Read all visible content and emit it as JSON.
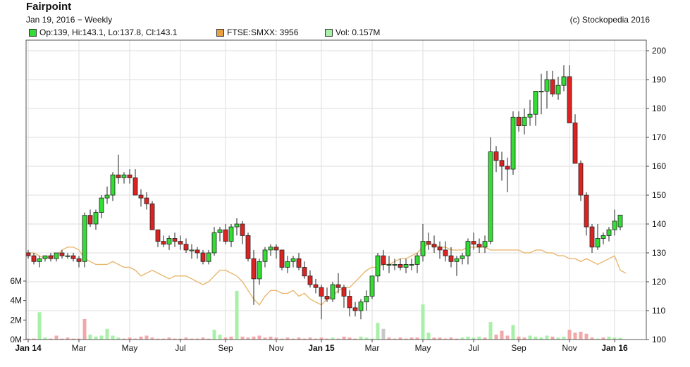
{
  "header": {
    "title": "Fairpoint",
    "subtitle": "Jan 19, 2016 − Weekly",
    "copyright": "(c) Stockopedia 2016"
  },
  "legend": {
    "ohlc": "Op:139, Hi:143.1, Lo:137.8, Cl:143.1",
    "index": "FTSE:SMXX: 3956",
    "volume": "Vol: 0.157M"
  },
  "colors": {
    "up": "#33dd33",
    "down": "#dd2222",
    "index_line": "#e8b870",
    "vol_up": "#a8f0a8",
    "vol_down": "#f2a8a8",
    "grid": "#dddddd"
  },
  "chart_data": {
    "type": "candlestick",
    "price_axis": {
      "side": "right",
      "ticks": [
        100,
        110,
        120,
        130,
        140,
        150,
        160,
        170,
        180,
        190,
        200
      ],
      "ylim": [
        100,
        200
      ]
    },
    "volume_axis": {
      "side": "left",
      "ticks": [
        "0M",
        "2M",
        "4M",
        "6M"
      ],
      "ylim": [
        0,
        6
      ]
    },
    "x_ticks": [
      {
        "label": "Jan 14",
        "week": 0,
        "bold": true
      },
      {
        "label": "Mar",
        "week": 9
      },
      {
        "label": "May",
        "week": 18
      },
      {
        "label": "Jul",
        "week": 27
      },
      {
        "label": "Sep",
        "week": 35
      },
      {
        "label": "Nov",
        "week": 44
      },
      {
        "label": "Jan 15",
        "week": 52,
        "bold": true
      },
      {
        "label": "Mar",
        "week": 61
      },
      {
        "label": "May",
        "week": 70
      },
      {
        "label": "Jul",
        "week": 79
      },
      {
        "label": "Sep",
        "week": 87
      },
      {
        "label": "Nov",
        "week": 96
      },
      {
        "label": "Jan 16",
        "week": 104,
        "bold": true
      }
    ],
    "candles": [
      [
        130,
        131,
        128,
        129
      ],
      [
        129,
        130,
        126,
        127
      ],
      [
        127,
        129,
        125,
        128
      ],
      [
        128,
        129,
        127,
        129
      ],
      [
        129,
        130,
        127,
        128
      ],
      [
        128,
        130,
        127,
        130
      ],
      [
        130,
        131,
        128,
        129
      ],
      [
        129,
        130,
        128,
        129
      ],
      [
        129,
        130,
        127,
        128
      ],
      [
        128,
        129,
        125,
        127
      ],
      [
        127,
        144,
        125,
        143
      ],
      [
        143,
        145,
        139,
        140
      ],
      [
        140,
        145,
        138,
        144
      ],
      [
        144,
        150,
        142,
        149
      ],
      [
        149,
        153,
        147,
        150
      ],
      [
        150,
        158,
        148,
        157
      ],
      [
        157,
        164,
        154,
        156
      ],
      [
        156,
        158,
        154,
        157
      ],
      [
        157,
        159,
        154,
        156
      ],
      [
        156,
        159,
        151,
        150
      ],
      [
        150,
        152,
        146,
        149
      ],
      [
        149,
        151,
        145,
        147
      ],
      [
        147,
        148,
        138,
        138
      ],
      [
        138,
        135,
        132,
        134
      ],
      [
        134,
        136,
        132,
        133
      ],
      [
        133,
        136,
        131,
        135
      ],
      [
        135,
        137,
        132,
        134
      ],
      [
        134,
        136,
        131,
        133
      ],
      [
        133,
        135,
        130,
        131
      ],
      [
        131,
        133,
        128,
        131
      ],
      [
        131,
        132,
        128,
        130
      ],
      [
        130,
        131,
        126,
        127
      ],
      [
        127,
        131,
        126,
        130
      ],
      [
        130,
        139,
        129,
        137
      ],
      [
        137,
        139,
        134,
        138
      ],
      [
        138,
        140,
        133,
        134
      ],
      [
        134,
        140,
        132,
        139
      ],
      [
        139,
        142,
        136,
        140
      ],
      [
        140,
        141,
        133,
        136
      ],
      [
        136,
        137,
        127,
        128
      ],
      [
        128,
        131,
        112,
        121
      ],
      [
        121,
        128,
        119,
        127
      ],
      [
        127,
        132,
        125,
        131
      ],
      [
        131,
        133,
        129,
        132
      ],
      [
        132,
        133,
        128,
        131
      ],
      [
        131,
        131,
        124,
        125
      ],
      [
        125,
        129,
        123,
        127
      ],
      [
        127,
        129,
        125,
        128
      ],
      [
        128,
        130,
        124,
        125
      ],
      [
        125,
        127,
        121,
        122
      ],
      [
        122,
        124,
        118,
        119
      ],
      [
        119,
        121,
        116,
        118
      ],
      [
        118,
        119,
        107,
        115
      ],
      [
        115,
        118,
        113,
        114
      ],
      [
        114,
        120,
        113,
        119
      ],
      [
        119,
        123,
        116,
        118
      ],
      [
        118,
        119,
        111,
        115
      ],
      [
        115,
        117,
        108,
        111
      ],
      [
        111,
        113,
        108,
        110
      ],
      [
        110,
        114,
        107,
        113
      ],
      [
        113,
        117,
        110,
        115
      ],
      [
        115,
        122,
        114,
        122
      ],
      [
        122,
        130,
        120,
        129
      ],
      [
        129,
        131,
        124,
        126
      ],
      [
        126,
        129,
        123,
        126
      ],
      [
        126,
        128,
        124,
        126
      ],
      [
        126,
        128,
        124,
        125
      ],
      [
        125,
        128,
        123,
        126
      ],
      [
        126,
        128,
        124,
        126
      ],
      [
        126,
        130,
        123,
        129
      ],
      [
        129,
        140,
        127,
        134
      ],
      [
        134,
        137,
        131,
        133
      ],
      [
        133,
        136,
        130,
        132
      ],
      [
        132,
        134,
        128,
        131
      ],
      [
        131,
        134,
        127,
        129
      ],
      [
        129,
        132,
        125,
        127
      ],
      [
        127,
        129,
        122,
        128
      ],
      [
        128,
        130,
        126,
        129
      ],
      [
        129,
        135,
        126,
        134
      ],
      [
        134,
        137,
        131,
        133
      ],
      [
        133,
        135,
        130,
        132
      ],
      [
        132,
        136,
        130,
        134
      ],
      [
        134,
        170,
        133,
        165
      ],
      [
        165,
        167,
        158,
        162
      ],
      [
        162,
        165,
        155,
        160
      ],
      [
        160,
        163,
        151,
        159
      ],
      [
        159,
        179,
        157,
        177
      ],
      [
        177,
        179,
        172,
        174
      ],
      [
        174,
        180,
        171,
        177
      ],
      [
        177,
        183,
        174,
        178
      ],
      [
        178,
        183,
        174,
        186
      ],
      [
        186,
        192,
        178,
        186
      ],
      [
        186,
        193,
        180,
        190
      ],
      [
        190,
        193,
        184,
        185
      ],
      [
        185,
        191,
        183,
        188
      ],
      [
        188,
        195,
        186,
        191
      ],
      [
        191,
        195,
        182,
        175
      ],
      [
        175,
        178,
        161,
        161
      ],
      [
        161,
        162,
        148,
        150
      ],
      [
        150,
        151,
        136,
        139
      ],
      [
        139,
        140,
        130,
        132
      ],
      [
        132,
        140,
        131,
        135
      ],
      [
        135,
        137,
        133,
        136
      ],
      [
        136,
        139,
        134,
        138
      ],
      [
        138,
        145,
        136,
        141
      ],
      [
        139,
        143.1,
        137.8,
        143.1
      ]
    ],
    "index_series": [
      130,
      130,
      129,
      128,
      129,
      129,
      131,
      132,
      132,
      131,
      128,
      127,
      126,
      126,
      126,
      127,
      126,
      125,
      125,
      124,
      122,
      123,
      124,
      123,
      122,
      121,
      122,
      122,
      122,
      121,
      120,
      119,
      120,
      122,
      124,
      124,
      123,
      122,
      120,
      117,
      114,
      112,
      115,
      117,
      117,
      116,
      116,
      117,
      115,
      116,
      114,
      113,
      112,
      114,
      115,
      117,
      118,
      118,
      120,
      122,
      124,
      125,
      125,
      126,
      126,
      127,
      128,
      128,
      129,
      130,
      132,
      133,
      133,
      132,
      132,
      131,
      131,
      131,
      132,
      132,
      132,
      132,
      131,
      131,
      131,
      131,
      131,
      131,
      130,
      130,
      131,
      131,
      130,
      130,
      129,
      129,
      128,
      128,
      127,
      128,
      127,
      126,
      127,
      128,
      129,
      124,
      123
    ],
    "volume": [
      [
        0.1,
        "d"
      ],
      [
        0.1,
        "d"
      ],
      [
        2.8,
        "u"
      ],
      [
        0.2,
        "u"
      ],
      [
        0.1,
        "d"
      ],
      [
        0.4,
        "d"
      ],
      [
        0.1,
        "d"
      ],
      [
        0.2,
        "d"
      ],
      [
        0.1,
        "d"
      ],
      [
        0.1,
        "d"
      ],
      [
        2.1,
        "d"
      ],
      [
        0.5,
        "u"
      ],
      [
        0.3,
        "u"
      ],
      [
        0.4,
        "u"
      ],
      [
        1.1,
        "u"
      ],
      [
        0.4,
        "u"
      ],
      [
        0.2,
        "u"
      ],
      [
        0.1,
        "d"
      ],
      [
        0.2,
        "d"
      ],
      [
        0.1,
        "d"
      ],
      [
        0.3,
        "d"
      ],
      [
        0.4,
        "d"
      ],
      [
        0.2,
        "d"
      ],
      [
        0.1,
        "d"
      ],
      [
        0.1,
        "d"
      ],
      [
        0.2,
        "d"
      ],
      [
        0.1,
        "d"
      ],
      [
        0.1,
        "d"
      ],
      [
        0.2,
        "d"
      ],
      [
        0.1,
        "d"
      ],
      [
        0.1,
        "d"
      ],
      [
        0.2,
        "d"
      ],
      [
        0.1,
        "d"
      ],
      [
        1.0,
        "u"
      ],
      [
        0.5,
        "u"
      ],
      [
        0.2,
        "d"
      ],
      [
        0.3,
        "d"
      ],
      [
        5.0,
        "u"
      ],
      [
        0.3,
        "d"
      ],
      [
        0.2,
        "d"
      ],
      [
        0.3,
        "d"
      ],
      [
        0.4,
        "d"
      ],
      [
        0.2,
        "d"
      ],
      [
        0.3,
        "d"
      ],
      [
        0.2,
        "d"
      ],
      [
        0.1,
        "d"
      ],
      [
        0.2,
        "d"
      ],
      [
        0.1,
        "d"
      ],
      [
        0.2,
        "d"
      ],
      [
        0.1,
        "d"
      ],
      [
        0.2,
        "d"
      ],
      [
        0.1,
        "d"
      ],
      [
        0.2,
        "d"
      ],
      [
        0.1,
        "d"
      ],
      [
        0.2,
        "u"
      ],
      [
        0.1,
        "d"
      ],
      [
        0.3,
        "d"
      ],
      [
        0.2,
        "d"
      ],
      [
        0.1,
        "d"
      ],
      [
        0.3,
        "u"
      ],
      [
        0.2,
        "u"
      ],
      [
        0.1,
        "u"
      ],
      [
        1.7,
        "u"
      ],
      [
        1.1,
        "n"
      ],
      [
        0.2,
        "d"
      ],
      [
        0.1,
        "d"
      ],
      [
        0.2,
        "d"
      ],
      [
        0.1,
        "d"
      ],
      [
        0.2,
        "d"
      ],
      [
        0.2,
        "d"
      ],
      [
        3.6,
        "u"
      ],
      [
        0.7,
        "u"
      ],
      [
        0.2,
        "d"
      ],
      [
        0.2,
        "d"
      ],
      [
        0.1,
        "d"
      ],
      [
        0.2,
        "d"
      ],
      [
        0.1,
        "d"
      ],
      [
        0.2,
        "u"
      ],
      [
        0.3,
        "u"
      ],
      [
        0.2,
        "u"
      ],
      [
        0.3,
        "u"
      ],
      [
        0.2,
        "d"
      ],
      [
        1.8,
        "u"
      ],
      [
        0.5,
        "d"
      ],
      [
        0.9,
        "d"
      ],
      [
        0.4,
        "d"
      ],
      [
        1.5,
        "u"
      ],
      [
        0.3,
        "d"
      ],
      [
        0.2,
        "d"
      ],
      [
        0.4,
        "u"
      ],
      [
        0.3,
        "u"
      ],
      [
        0.2,
        "u"
      ],
      [
        0.4,
        "u"
      ],
      [
        0.3,
        "d"
      ],
      [
        0.2,
        "u"
      ],
      [
        0.3,
        "u"
      ],
      [
        1.0,
        "d"
      ],
      [
        0.7,
        "d"
      ],
      [
        0.8,
        "d"
      ],
      [
        0.6,
        "d"
      ],
      [
        0.2,
        "d"
      ],
      [
        0.1,
        "u"
      ],
      [
        0.2,
        "d"
      ],
      [
        0.3,
        "u"
      ],
      [
        0.2,
        "u"
      ],
      [
        0.16,
        "u"
      ]
    ]
  }
}
